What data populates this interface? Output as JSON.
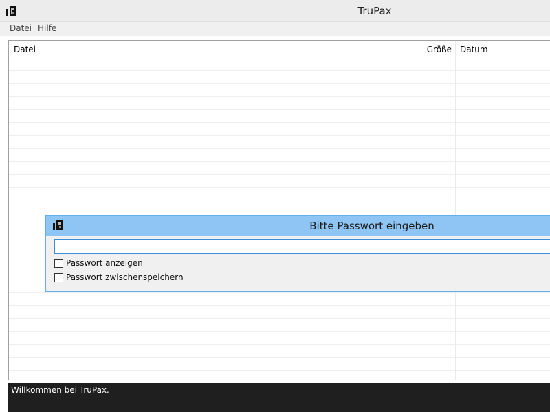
{
  "window": {
    "title": "TruPax"
  },
  "menu": {
    "items": [
      {
        "label": "Datei"
      },
      {
        "label": "Hilfe"
      }
    ]
  },
  "table": {
    "columns": [
      {
        "label": "Datei"
      },
      {
        "label": "Größe"
      },
      {
        "label": "Datum"
      }
    ]
  },
  "status": {
    "text": "Willkommen bei TruPax."
  },
  "dialog": {
    "title": "Bitte Passwort eingeben",
    "password_value": "",
    "checkboxes": [
      {
        "label": "Passwort anzeigen",
        "checked": false
      },
      {
        "label": "Passwort zwischenspeichern",
        "checked": false
      }
    ]
  },
  "colors": {
    "dialog_titlebar": "#8ec5f5",
    "statusbar": "#1f1f1f",
    "input_border": "#3a8ed8"
  },
  "icons": {
    "app": "trupax-logo-icon"
  }
}
